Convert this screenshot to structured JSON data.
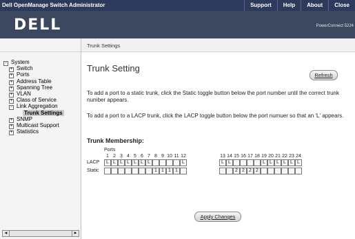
{
  "titlebar": {
    "app_title": "Dell OpenManage Switch Administrator",
    "menu": [
      "Support",
      "Help",
      "About",
      "Close"
    ]
  },
  "banner": {
    "logo": "DELL",
    "product": "PowerConnect 5224"
  },
  "tree": [
    {
      "label": "System",
      "level": 0,
      "expander": "−"
    },
    {
      "label": "Switch",
      "level": 1,
      "expander": "+"
    },
    {
      "label": "Ports",
      "level": 1,
      "expander": "+"
    },
    {
      "label": "Address Table",
      "level": 1,
      "expander": "+"
    },
    {
      "label": "Spanning Tree",
      "level": 1,
      "expander": "+"
    },
    {
      "label": "VLAN",
      "level": 1,
      "expander": "+"
    },
    {
      "label": "Class of Service",
      "level": 1,
      "expander": "+"
    },
    {
      "label": "Link Aggregation",
      "level": 1,
      "expander": "−"
    },
    {
      "label": "Trunk Settings",
      "level": 2,
      "expander": ""
    },
    {
      "label": "SNMP",
      "level": 1,
      "expander": "+"
    },
    {
      "label": "Multicast Support",
      "level": 1,
      "expander": "+"
    },
    {
      "label": "Statistics",
      "level": 1,
      "expander": "+"
    }
  ],
  "breadcrumb": "Trunk Settings",
  "page_title": "Trunk Setting",
  "refresh_label": "Refresh",
  "instructions": {
    "static": "To add a port to a static trunk, click the Static toggle button below the port number until the correct trunk number appears.",
    "lacp": "To add a port to a LACP trunk, click the LACP toggle button below the port numuer so that an 'L' appears."
  },
  "membership_title": "Trunk Membership:",
  "ports_label": "Ports",
  "lacp_label": "LACP",
  "static_label": "Static",
  "group1": {
    "ports": [
      "1",
      "2",
      "3",
      "4",
      "5",
      "6",
      "7",
      "8",
      "9",
      "10",
      "11",
      "12"
    ],
    "lacp": [
      "L",
      "L",
      "L",
      "L",
      "L",
      "L",
      "L",
      "",
      "",
      "",
      "",
      "L"
    ],
    "static": [
      "",
      "",
      "",
      "",
      "",
      "",
      "",
      "1",
      "1",
      "1",
      "1",
      ""
    ]
  },
  "group2": {
    "ports": [
      "13",
      "14",
      "15",
      "16",
      "17",
      "18",
      "19",
      "20",
      "21",
      "22",
      "23",
      "24"
    ],
    "lacp": [
      "L",
      "L",
      "",
      "",
      "",
      "",
      "L",
      "L",
      "L",
      "L",
      "L",
      "L"
    ],
    "static": [
      "",
      "",
      "2",
      "2",
      "2",
      "2",
      "",
      "",
      "",
      "",
      "",
      ""
    ]
  },
  "apply_label": "Apply Changes"
}
